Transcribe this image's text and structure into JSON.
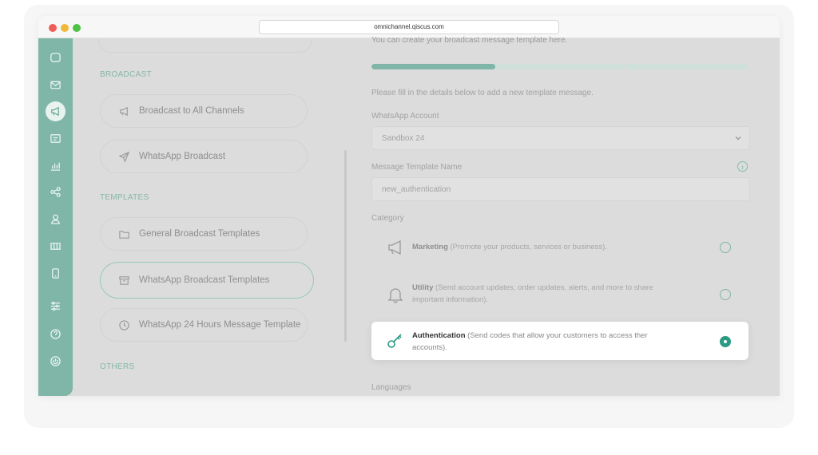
{
  "browser": {
    "url": "omnichannel.qiscus.com"
  },
  "rail": {
    "icons": [
      "chat-icon",
      "mail-icon",
      "megaphone-icon",
      "contact-card-icon",
      "analytics-icon",
      "share-nodes-icon",
      "user-icon",
      "ticket-icon",
      "phone-icon",
      "sliders-icon",
      "help-icon",
      "power-icon"
    ],
    "active": "megaphone-icon"
  },
  "sidebar": {
    "broadcast_header": "BROADCAST",
    "broadcast_items": [
      {
        "label": "Broadcast to All Channels",
        "icon": "megaphone-icon"
      },
      {
        "label": "WhatsApp Broadcast",
        "icon": "send-icon"
      }
    ],
    "templates_header": "TEMPLATES",
    "template_items": [
      {
        "label": "General Broadcast Templates",
        "icon": "folder-icon"
      },
      {
        "label": "WhatsApp Broadcast Templates",
        "icon": "archive-icon",
        "active": true
      },
      {
        "label": "WhatsApp 24 Hours Message Template",
        "icon": "clock-icon"
      }
    ],
    "others_header": "OTHERS"
  },
  "form": {
    "subtitle": "You can create your broadcast message template here.",
    "progress": 0.33,
    "instructions": "Please fill in the details below to add a new template message.",
    "account_label": "WhatsApp Account",
    "account_value": "Sandbox 24",
    "template_name_label": "Message Template Name",
    "template_name_value": "new_authentication",
    "category_label": "Category",
    "categories": [
      {
        "name": "Marketing",
        "desc": "(Promote your products, services or business).",
        "icon": "megaphone-icon",
        "selected": false
      },
      {
        "name": "Utility",
        "desc": "(Send account updates, order updates, alerts, and more to share important information).",
        "icon": "bell-icon",
        "selected": false
      },
      {
        "name": "Authentication",
        "desc": "(Send codes that allow your customers to access ther accounts).",
        "icon": "key-icon",
        "selected": true
      }
    ],
    "languages_label": "Languages"
  },
  "colors": {
    "accent": "#7fb6a7",
    "accent_dark": "#2a9a83",
    "overlay": "#dcdcdc"
  }
}
